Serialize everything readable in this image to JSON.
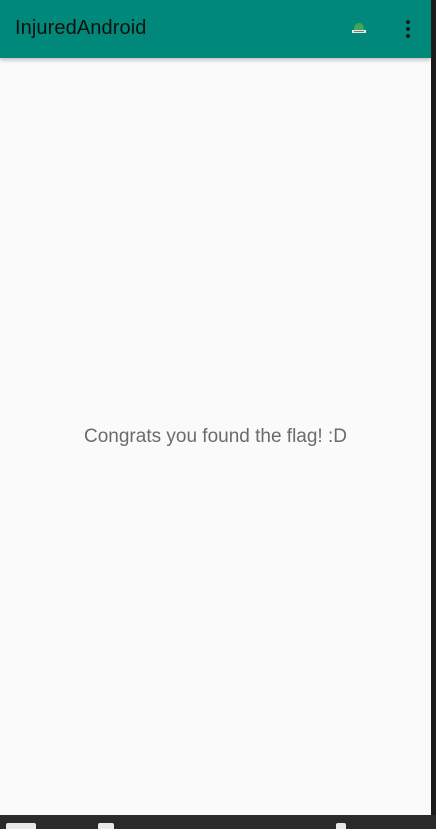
{
  "app_bar": {
    "title": "InjuredAndroid",
    "background_color": "#00897b",
    "actions": [
      {
        "icon": "hat-icon",
        "label": ""
      },
      {
        "icon": "more-vert-icon",
        "label": ""
      }
    ]
  },
  "main": {
    "message": "Congrats you found the flag! :D",
    "background_color": "#fafafa"
  }
}
